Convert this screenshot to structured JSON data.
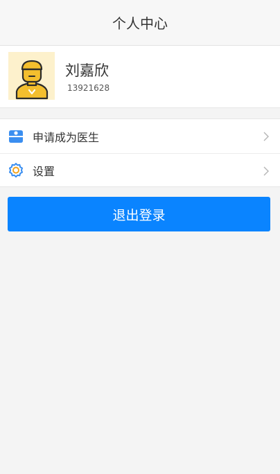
{
  "header": {
    "title": "个人中心"
  },
  "profile": {
    "name": "刘嘉欣",
    "phone": "13921628",
    "avatar_icon": "doctor-avatar-icon"
  },
  "menu": {
    "items": [
      {
        "label": "申请成为医生",
        "icon": "medical-kit-icon"
      },
      {
        "label": "设置",
        "icon": "gear-icon"
      }
    ]
  },
  "logout": {
    "label": "退出登录"
  },
  "colors": {
    "accent": "#0a84ff",
    "avatar_bg": "#fdf1cc",
    "avatar_figure": "#f4bf2e",
    "background": "#f4f4f4"
  }
}
